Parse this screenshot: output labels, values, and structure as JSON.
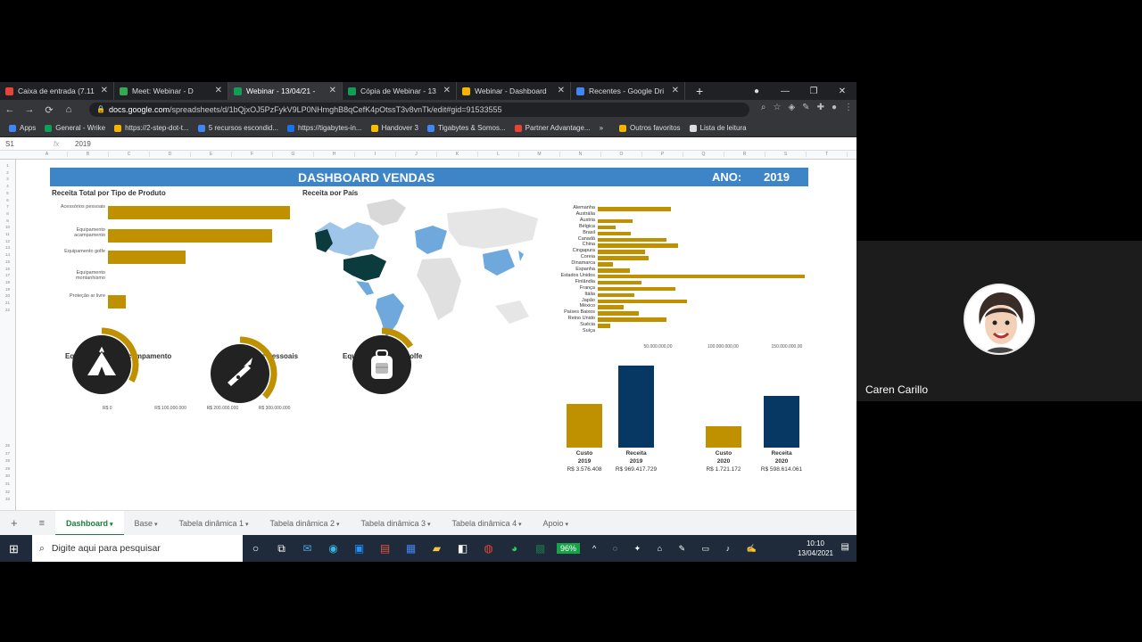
{
  "browser": {
    "tabs": [
      {
        "title": "Caixa de entrada (7.11",
        "color": "#ea4335",
        "active": false
      },
      {
        "title": "Meet: Webinar - D",
        "color": "#34a853",
        "active": false
      },
      {
        "title": "Webinar - 13/04/21 - ",
        "color": "#0f9d58",
        "active": true
      },
      {
        "title": "Cópia de Webinar - 13",
        "color": "#0f9d58",
        "active": false
      },
      {
        "title": "Webinar - Dashboard",
        "color": "#f4b400",
        "active": false
      },
      {
        "title": "Recentes - Google Dri",
        "color": "#4285f4",
        "active": false
      }
    ],
    "new_tab": "+",
    "url_host": "docs.google.com",
    "url_path": "/spreadsheets/d/1bQjxOJ5PzFykV9LP0NHmghB8qCefK4pOtssT3v8vnTk/edit#gid=91533555",
    "bookmarks": [
      "Apps",
      "General - Wrike",
      "https://2-step-dot-t...",
      "5 recursos escondid...",
      "https://tigabytes-in...",
      "Handover 3",
      "Tigabytes & Somos...",
      "Partner Advantage..."
    ],
    "bookmarks_more": "»",
    "other_favorites": "Outros favoritos",
    "reading_list": "Lista de leitura"
  },
  "sheet": {
    "cell_ref": "S1",
    "fx": "fx",
    "formula_value": "2019",
    "columns": [
      "A",
      "B",
      "C",
      "D",
      "E",
      "F",
      "G",
      "H",
      "I",
      "J",
      "K",
      "L",
      "M",
      "N",
      "O",
      "P",
      "Q",
      "R",
      "S",
      "T"
    ],
    "rows": [
      "1",
      "2",
      "3",
      "4",
      "5",
      "6",
      "7",
      "8",
      "9",
      "10",
      "11",
      "12",
      "13",
      "14",
      "15",
      "16",
      "17",
      "18",
      "19",
      "20",
      "21",
      "22",
      "26",
      "27",
      "28",
      "29",
      "30",
      "31",
      "32",
      "33"
    ]
  },
  "dashboard": {
    "title": "DASHBOARD VENDAS",
    "ano_label": "ANO:",
    "ano_value": "2019",
    "receita_tipo_title": "Receita Total por Tipo de Produto",
    "receita_pais_title": "Receita por País",
    "acampamento_title": "Equipamento de Acampamento",
    "acessorios_title": "Acessórios Pessoais",
    "golfe_title": "Equipamentos de Golfe"
  },
  "chart_data": [
    {
      "type": "bar",
      "orientation": "horizontal",
      "title": "Receita Total por Tipo de Produto",
      "categories": [
        "Acessórios pessoais",
        "Equipamento acampamento",
        "Equipamento golfe",
        "Equipamento montanhismo",
        "Proteção ar livre"
      ],
      "values": [
        350000000,
        315000000,
        150000000,
        0,
        35000000
      ],
      "ticks": [
        "R$ 0",
        "R$ 100.000.000",
        "R$ 200.000.000",
        "R$ 300.000.000"
      ],
      "xlim": [
        0,
        350000000
      ],
      "color": "#bf9000"
    },
    {
      "type": "bar",
      "orientation": "horizontal",
      "title": "",
      "categories": [
        "Alemanha",
        "Austrália",
        "Áustria",
        "Bélgica",
        "Brasil",
        "Canadá",
        "China",
        "Cingapura",
        "Coreia",
        "Dinamarca",
        "Espanha",
        "Estados Unidos",
        "Finlândia",
        "França",
        "Itália",
        "Japão",
        "México",
        "Países Baixos",
        "Reino Unido",
        "Suécia",
        "Suíça"
      ],
      "values": [
        57000000,
        0,
        27000000,
        14000000,
        26000000,
        54000000,
        63000000,
        37000000,
        40000000,
        12000000,
        25000000,
        162000000,
        34000000,
        61000000,
        29000000,
        70000000,
        20000000,
        32000000,
        54000000,
        10000000,
        0
      ],
      "ticks": [
        "50.000.000,00",
        "100.000.000,00",
        "150.000.000,00"
      ],
      "xlim": [
        0,
        165000000
      ],
      "color": "#bf9000"
    },
    {
      "type": "gauge",
      "title": "Equipamento de Acampamento",
      "value": 0.33,
      "icon": "tent-icon"
    },
    {
      "type": "gauge",
      "title": "Acessórios Pessoais",
      "value": 0.37,
      "icon": "swiss-knife-icon"
    },
    {
      "type": "gauge",
      "title": "Equipamentos de Golfe",
      "value": 0.16,
      "icon": "backpack-icon"
    },
    {
      "type": "bar",
      "title": "",
      "categories": [
        "Custo 2019",
        "Receita 2019",
        "Custo 2020",
        "Receita 2020"
      ],
      "labels": [
        {
          "name": "Custo",
          "year": "2019",
          "value": "R$ 3.576.408"
        },
        {
          "name": "Receita",
          "year": "2019",
          "value": "R$ 969.417.729"
        },
        {
          "name": "Custo",
          "year": "2020",
          "value": "R$ 1.721.172"
        },
        {
          "name": "Receita",
          "year": "2020",
          "value": "R$ 598.614.061"
        }
      ],
      "relative_heights": [
        0.53,
        1.0,
        0.26,
        0.63
      ],
      "colors": [
        "#bf9000",
        "#073763",
        "#bf9000",
        "#073763"
      ]
    }
  ],
  "sheet_tabs": {
    "add": "+",
    "list": "≡",
    "tabs": [
      "Dashboard",
      "Base",
      "Tabela dinâmica 1",
      "Tabela dinâmica 2",
      "Tabela dinâmica 3",
      "Tabela dinâmica 4",
      "Apoio"
    ],
    "active": 0
  },
  "taskbar": {
    "search_placeholder": "Digite aqui para pesquisar",
    "battery": "96%",
    "time": "10:10",
    "date": "13/04/2021"
  },
  "video": {
    "participant": "Caren Carillo"
  },
  "colors": {
    "gold": "#bf9000",
    "navy": "#073763",
    "banner": "#3d85c6",
    "gauge_bg": "#222222"
  }
}
